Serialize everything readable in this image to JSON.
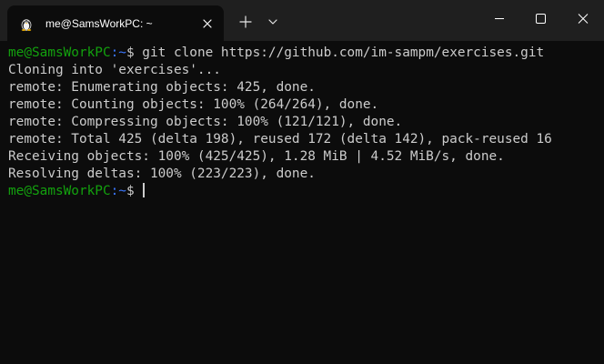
{
  "tab": {
    "title": "me@SamsWorkPC: ~",
    "icon": "linux-penguin-icon"
  },
  "titlebar": {
    "new_tab_icon": "plus-icon",
    "dropdown_icon": "chevron-down-icon",
    "minimize_icon": "minimize-icon",
    "maximize_icon": "maximize-icon",
    "close_icon": "close-icon"
  },
  "terminal": {
    "prompt_user": "me@SamsWorkPC",
    "prompt_path": ":~",
    "prompt_sign": "$ ",
    "command": "git clone https://github.com/im-sampm/exercises.git",
    "output": [
      "Cloning into 'exercises'...",
      "remote: Enumerating objects: 425, done.",
      "remote: Counting objects: 100% (264/264), done.",
      "remote: Compressing objects: 100% (121/121), done.",
      "remote: Total 425 (delta 198), reused 172 (delta 142), pack-reused 16",
      "Receiving objects: 100% (425/425), 1.28 MiB | 4.52 MiB/s, done.",
      "Resolving deltas: 100% (223/223), done."
    ]
  },
  "colors": {
    "background": "#0c0c0c",
    "titlebar": "#1f1f1f",
    "text": "#cccccc",
    "prompt_user": "#13a10e",
    "prompt_path": "#3b78ff"
  }
}
